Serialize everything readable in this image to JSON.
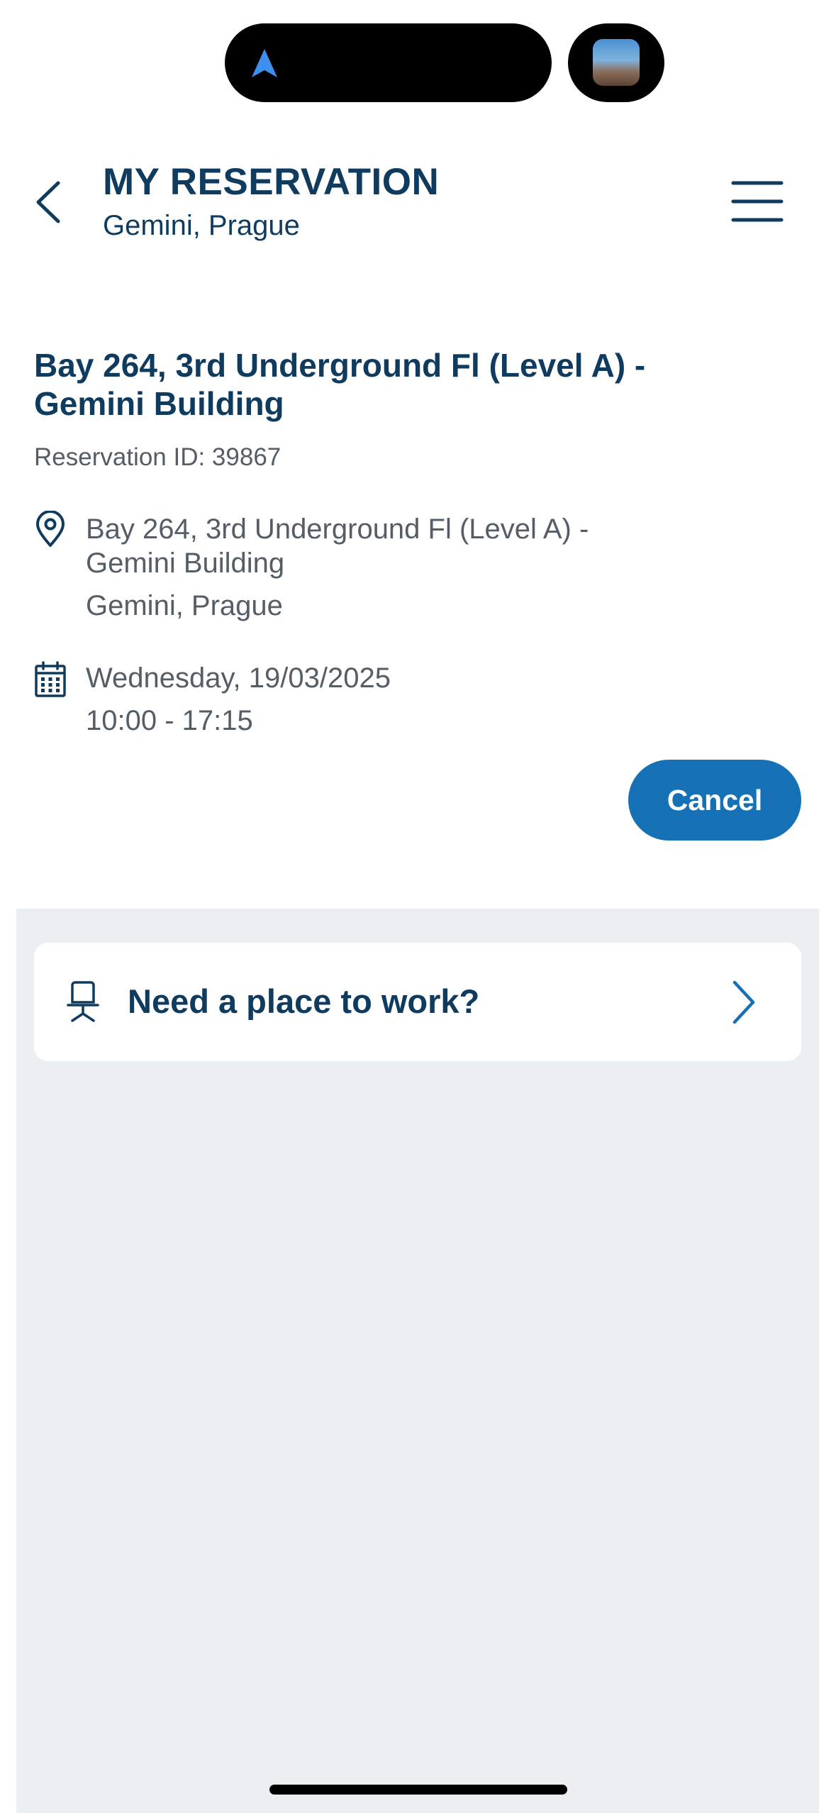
{
  "status": {
    "left_icon": "location-arrow-icon",
    "right_icon": "live-activity-thumbnail"
  },
  "header": {
    "title": "MY RESERVATION",
    "subtitle": "Gemini, Prague",
    "back_icon": "chevron-left-icon",
    "menu_icon": "hamburger-menu-icon"
  },
  "reservation": {
    "heading": "Bay 264, 3rd Underground Fl (Level A) - Gemini Building",
    "id_text": "Reservation ID: 39867",
    "location_line1": "Bay 264, 3rd Underground Fl (Level A) -",
    "location_line2": "Gemini Building",
    "location_line3": "Gemini, Prague",
    "date": "Wednesday, 19/03/2025",
    "time": "10:00 - 17:15",
    "cancel_label": "Cancel"
  },
  "work_card": {
    "label": "Need a place to work?",
    "icon": "office-chair-icon",
    "chevron": "chevron-right-icon"
  },
  "colors": {
    "primary": "#0f3b5f",
    "accent": "#1570b5",
    "muted": "#555d66",
    "background_grey": "#ebeff2"
  }
}
